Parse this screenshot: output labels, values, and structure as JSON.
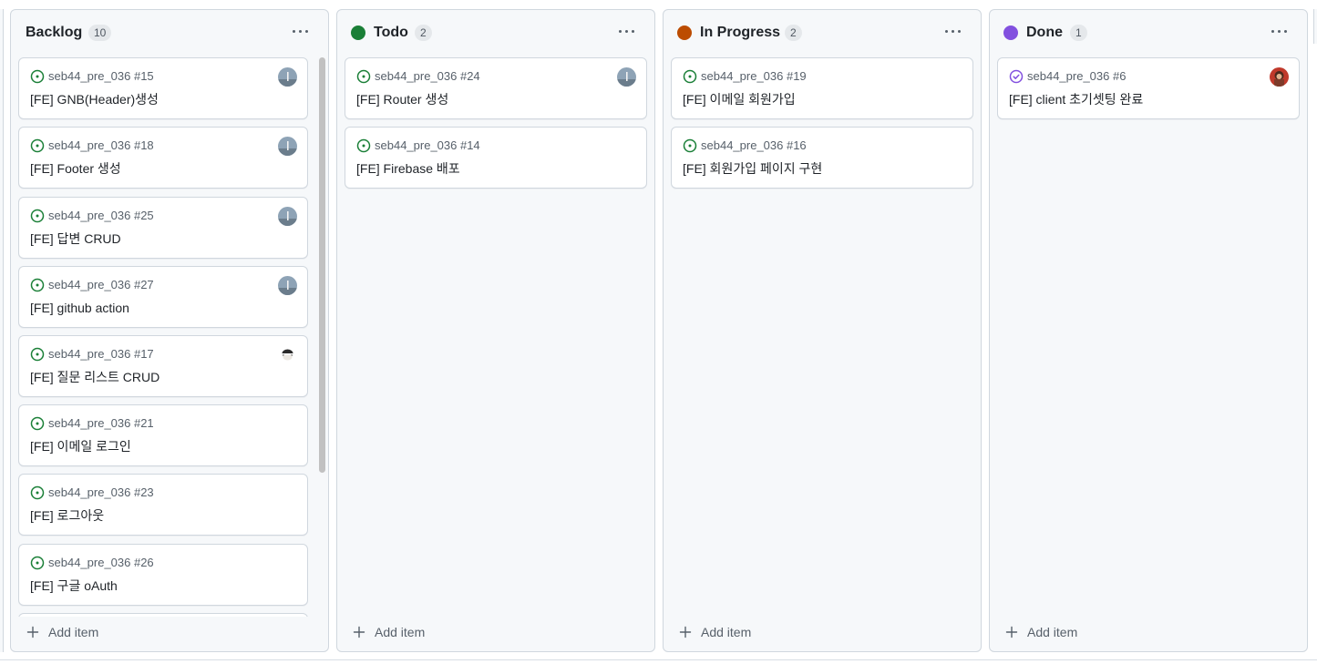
{
  "columns": [
    {
      "title": "Backlog",
      "count": "10",
      "dot_color": "",
      "cards": [
        {
          "ref": "seb44_pre_036 #15",
          "title": "[FE] GNB(Header)생성",
          "state": "open",
          "avatar": "landscape"
        },
        {
          "ref": "seb44_pre_036 #18",
          "title": "[FE] Footer 생성",
          "state": "open",
          "avatar": "landscape"
        },
        {
          "ref": "seb44_pre_036 #25",
          "title": "[FE] 답변 CRUD",
          "state": "open",
          "avatar": "landscape"
        },
        {
          "ref": "seb44_pre_036 #27",
          "title": "[FE] github action",
          "state": "open",
          "avatar": "landscape"
        },
        {
          "ref": "seb44_pre_036 #17",
          "title": "[FE] 질문 리스트 CRUD",
          "state": "open",
          "avatar": "cartoon"
        },
        {
          "ref": "seb44_pre_036 #21",
          "title": "[FE] 이메일 로그인",
          "state": "open",
          "avatar": ""
        },
        {
          "ref": "seb44_pre_036 #23",
          "title": "[FE] 로그아웃",
          "state": "open",
          "avatar": ""
        },
        {
          "ref": "seb44_pre_036 #26",
          "title": "[FE] 구글 oAuth",
          "state": "open",
          "avatar": ""
        }
      ],
      "add_label": "Add item"
    },
    {
      "title": "Todo",
      "count": "2",
      "dot_color": "#1a7f37",
      "cards": [
        {
          "ref": "seb44_pre_036 #24",
          "title": "[FE] Router 생성",
          "state": "open",
          "avatar": "landscape"
        },
        {
          "ref": "seb44_pre_036 #14",
          "title": "[FE] Firebase 배포",
          "state": "open",
          "avatar": ""
        }
      ],
      "add_label": "Add item"
    },
    {
      "title": "In Progress",
      "count": "2",
      "dot_color": "#bc4c00",
      "cards": [
        {
          "ref": "seb44_pre_036 #19",
          "title": "[FE] 이메일 회원가입",
          "state": "open",
          "avatar": ""
        },
        {
          "ref": "seb44_pre_036 #16",
          "title": "[FE] 회원가입 페이지 구현",
          "state": "open",
          "avatar": ""
        }
      ],
      "add_label": "Add item"
    },
    {
      "title": "Done",
      "count": "1",
      "dot_color": "#8250df",
      "cards": [
        {
          "ref": "seb44_pre_036 #6",
          "title": "[FE] client 초기셋팅 완료",
          "state": "closed",
          "avatar": "portrait"
        }
      ],
      "add_label": "Add item"
    }
  ],
  "colors": {
    "open_issue": "#1a7f37",
    "closed_issue": "#8250df",
    "column_bg": "#f6f8fa",
    "border": "#d0d7de"
  },
  "icons": {
    "open_state": "issue-opened-icon",
    "closed_state": "issue-closed-icon",
    "menu": "kebab-horizontal-icon",
    "add": "plus-icon"
  }
}
